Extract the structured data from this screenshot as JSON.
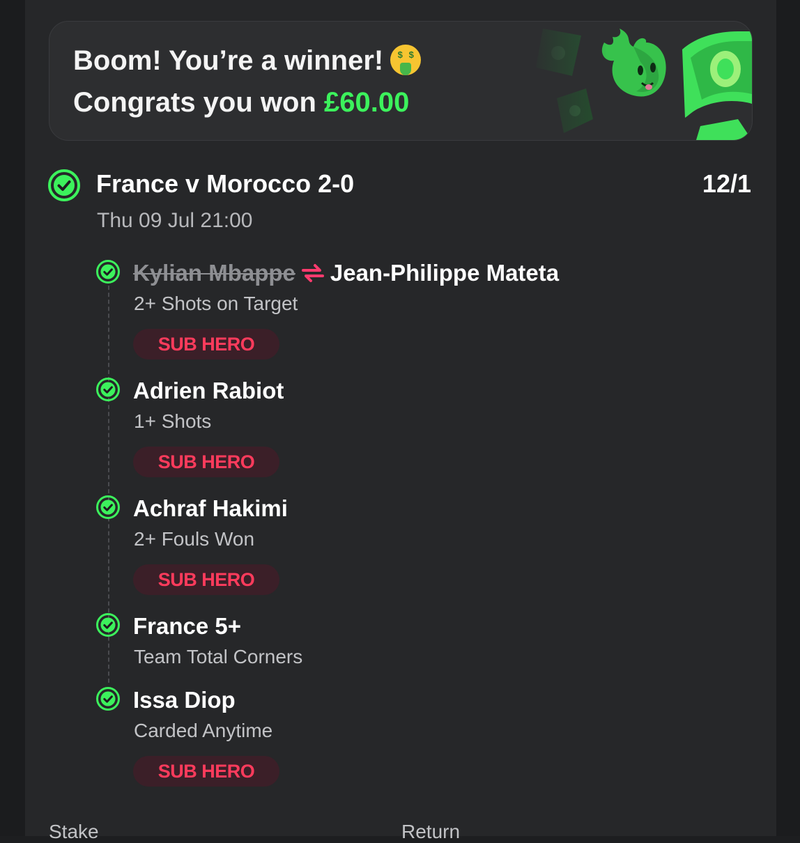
{
  "banner": {
    "line1": "Boom! You’re a winner!",
    "line2_prefix": "Congrats you won ",
    "amount": "£60.00",
    "emoji_icon": "money-mouth-face-icon",
    "accent_color": "#3cf25c"
  },
  "event": {
    "title": "France v Morocco 2-0",
    "odds": "12/1",
    "datetime": "Thu 09 Jul 21:00",
    "status_icon": "check-circle-icon"
  },
  "legs": [
    {
      "original_player": "Kylian Mbappe",
      "name": "Jean-Philippe Mateta",
      "market": "2+ Shots on Target",
      "badge": "SUB HERO"
    },
    {
      "name": "Adrien Rabiot",
      "market": "1+ Shots",
      "badge": "SUB HERO"
    },
    {
      "name": "Achraf Hakimi",
      "market": "2+ Fouls Won",
      "badge": "SUB HERO"
    },
    {
      "name": "France 5+",
      "market": "Team Total Corners"
    },
    {
      "name": "Issa Diop",
      "market": "Carded Anytime",
      "badge": "SUB HERO"
    }
  ],
  "footer": {
    "stake_label": "Stake",
    "return_label": "Return"
  },
  "colors": {
    "win_green": "#3cf25c",
    "badge_text": "#ff3b5c",
    "badge_bg": "#3b1f28",
    "swap_pink": "#ff3b6e"
  }
}
